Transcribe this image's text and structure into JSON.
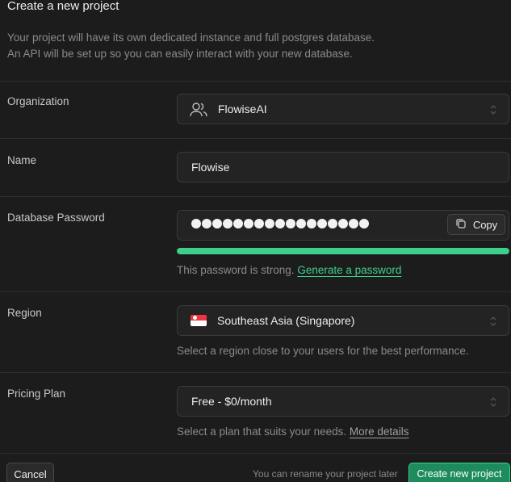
{
  "header": {
    "title": "Create a new project",
    "description_line1": "Your project will have its own dedicated instance and full postgres database.",
    "description_line2": "An API will be set up so you can easily interact with your new database."
  },
  "organization": {
    "label": "Organization",
    "value": "FlowiseAI",
    "icon": "users-icon"
  },
  "name": {
    "label": "Name",
    "value": "Flowise"
  },
  "password": {
    "label": "Database Password",
    "masked_length": 17,
    "copy_label": "Copy",
    "strength_fraction": 1.0,
    "strength_color": "#3ecf8e",
    "strength_text": "This password is strong.",
    "generate_link": "Generate a password"
  },
  "region": {
    "label": "Region",
    "value": "Southeast Asia (Singapore)",
    "hint": "Select a region close to your users for the best performance."
  },
  "pricing": {
    "label": "Pricing Plan",
    "value": "Free - $0/month",
    "hint": "Select a plan that suits your needs.",
    "details_link": "More details"
  },
  "footer": {
    "cancel_label": "Cancel",
    "note": "You can rename your project later",
    "create_label": "Create new project"
  },
  "colors": {
    "accent": "#3ecf8e",
    "background": "#1c1c1c"
  }
}
